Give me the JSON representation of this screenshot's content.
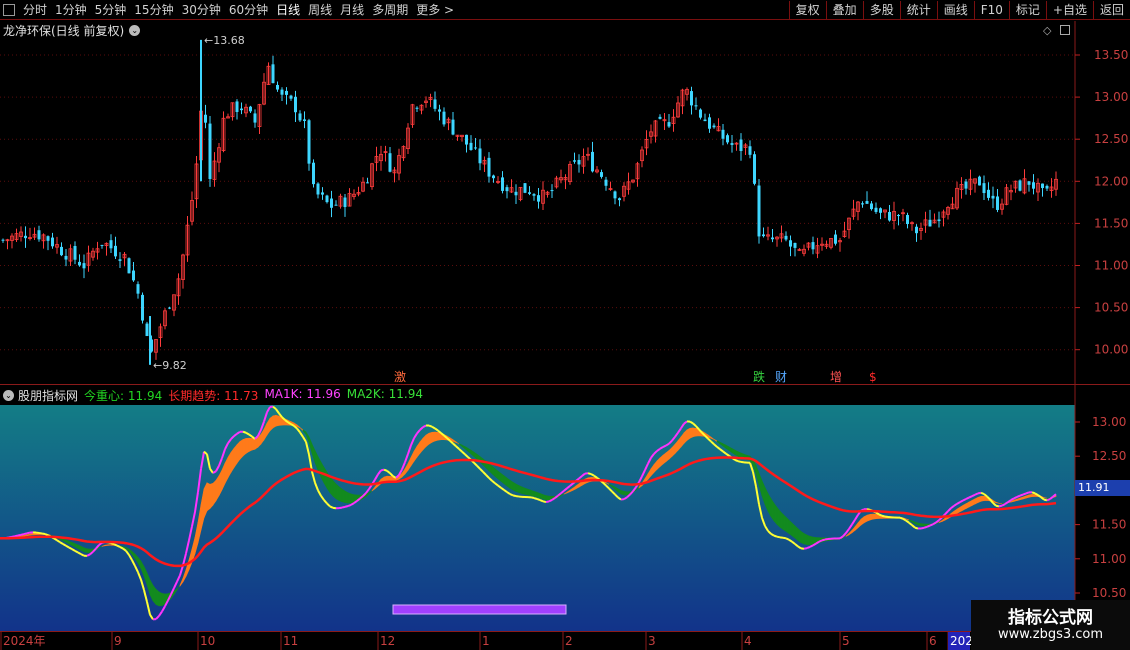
{
  "toolbar": {
    "periods": [
      "分时",
      "1分钟",
      "5分钟",
      "15分钟",
      "30分钟",
      "60分钟",
      "日线",
      "周线",
      "月线",
      "多周期",
      "更多 >"
    ],
    "active_period": "日线",
    "actions": [
      "复权",
      "叠加",
      "多股",
      "统计",
      "画线",
      "F10",
      "标记",
      "+自选",
      "返回"
    ]
  },
  "main": {
    "title": "龙净环保(日线 前复权)",
    "price_axis": [
      "13.50",
      "13.00",
      "12.50",
      "12.00",
      "11.50",
      "11.00",
      "10.50",
      "10.00"
    ],
    "high_label": "13.68",
    "low_label": "9.82",
    "events": [
      {
        "text": "激",
        "color": "#ff6a3d"
      },
      {
        "text": "跌",
        "color": "#36d13f"
      },
      {
        "text": "财",
        "color": "#56a8ff"
      },
      {
        "text": "增",
        "color": "#ff5252"
      },
      {
        "text": "$",
        "color": "#ff2a2a"
      }
    ],
    "colors": {
      "up": "#ff3c3c",
      "down": "#3ed6ff"
    }
  },
  "indicator": {
    "name": "股朋指标网",
    "legend": [
      {
        "label": "今重心: 11.94",
        "color": "#22d422"
      },
      {
        "label": "长期趋势: 11.73",
        "color": "#ff2a2a"
      },
      {
        "label": "MA1K: 11.96",
        "color": "#ff44ff"
      },
      {
        "label": "MA2K: 11.94",
        "color": "#38e038"
      }
    ],
    "axis": [
      "13.00",
      "12.50",
      "12.00",
      "11.50",
      "11.00",
      "10.50"
    ],
    "current_value": "11.91"
  },
  "time_axis": [
    "2024年",
    "9",
    "10",
    "11",
    "12",
    "1",
    "2",
    "3",
    "4",
    "5",
    "6",
    "202"
  ],
  "watermark": {
    "line1": "指标公式网",
    "line2": "www.zbgs3.com"
  }
}
